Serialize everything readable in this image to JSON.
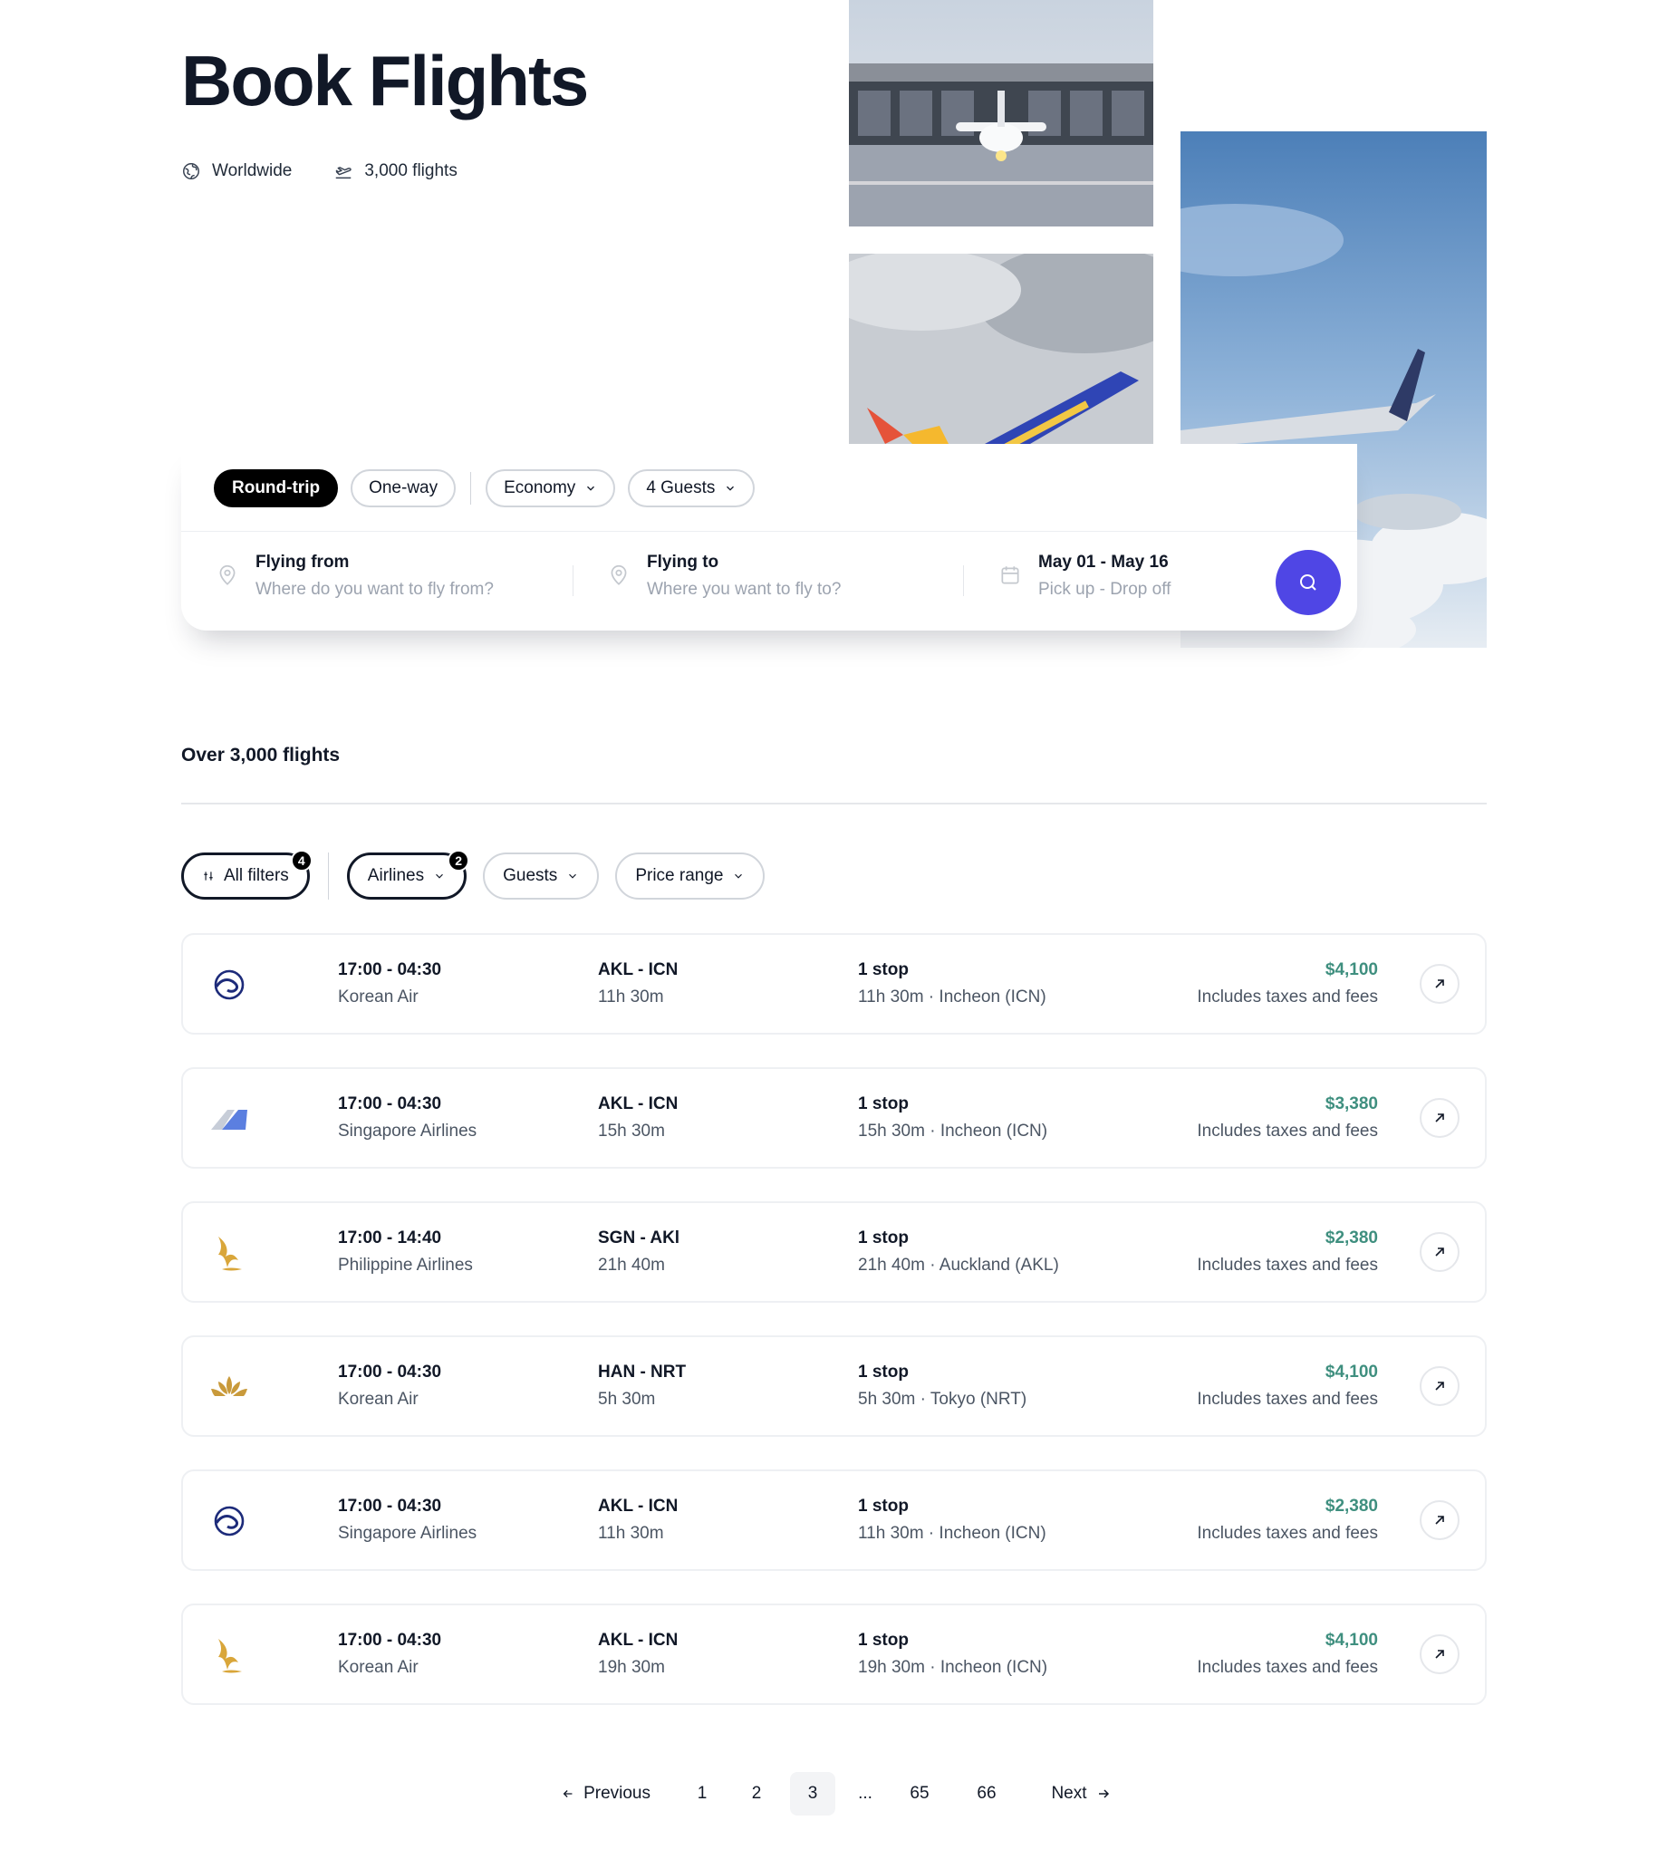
{
  "header": {
    "title": "Book Flights",
    "meta": [
      {
        "icon": "globe-icon",
        "label": "Worldwide"
      },
      {
        "icon": "plane-takeoff-icon",
        "label": "3,000 flights"
      }
    ]
  },
  "search": {
    "trip_types": [
      "Round-trip",
      "One-way"
    ],
    "active_trip": "Round-trip",
    "cabin_class": "Economy",
    "guests": "4 Guests",
    "from": {
      "label": "Flying from",
      "placeholder": "Where do you want to fly from?",
      "icon": "location-pin-icon"
    },
    "to": {
      "label": "Flying to",
      "placeholder": "Where you want to fly to?",
      "icon": "location-pin-icon"
    },
    "dates": {
      "label": "May 01 - May 16",
      "sub": "Pick up - Drop off",
      "icon": "calendar-icon"
    },
    "button_icon": "search-icon"
  },
  "results": {
    "title": "Over 3,000 flights",
    "filters": {
      "all_filters": {
        "label": "All filters",
        "badge": "4"
      },
      "airlines": {
        "label": "Airlines",
        "badge": "2"
      },
      "guests": {
        "label": "Guests"
      },
      "price_range": {
        "label": "Price range"
      }
    },
    "flights": [
      {
        "logo": "korean-air-logo-icon",
        "time": "17:00 - 04:30",
        "airline": "Korean Air",
        "route": "AKL - ICN",
        "duration": "11h 30m",
        "stops": "1 stop",
        "stop_detail": "11h 30m · Incheon (ICN)",
        "price": "$4,100",
        "price_note": "Includes taxes and fees"
      },
      {
        "logo": "tail-fin-logo-icon",
        "time": "17:00 - 04:30",
        "airline": "Singapore Airlines",
        "route": "AKL - ICN",
        "duration": "15h 30m",
        "stops": "1 stop",
        "stop_detail": "15h 30m · Incheon (ICN)",
        "price": "$3,380",
        "price_note": "Includes taxes and fees"
      },
      {
        "logo": "singapore-bird-logo-icon",
        "time": "17:00 - 14:40",
        "airline": "Philippine Airlines",
        "route": "SGN - AKl",
        "duration": "21h 40m",
        "stops": "1 stop",
        "stop_detail": "21h 40m · Auckland (AKL)",
        "price": "$2,380",
        "price_note": "Includes taxes and fees"
      },
      {
        "logo": "lotus-logo-icon",
        "time": "17:00 - 04:30",
        "airline": "Korean Air",
        "route": "HAN - NRT",
        "duration": "5h 30m",
        "stops": "1 stop",
        "stop_detail": "5h 30m · Tokyo (NRT)",
        "price": "$4,100",
        "price_note": "Includes taxes and fees"
      },
      {
        "logo": "korean-air-logo-icon",
        "time": "17:00 - 04:30",
        "airline": "Singapore Airlines",
        "route": "AKL - ICN",
        "duration": "11h 30m",
        "stops": "1 stop",
        "stop_detail": "11h 30m · Incheon (ICN)",
        "price": "$2,380",
        "price_note": "Includes taxes and fees"
      },
      {
        "logo": "singapore-bird-logo-icon",
        "time": "17:00 - 04:30",
        "airline": "Korean Air",
        "route": "AKL - ICN",
        "duration": "19h 30m",
        "stops": "1 stop",
        "stop_detail": "19h 30m · Incheon (ICN)",
        "price": "$4,100",
        "price_note": "Includes taxes and fees"
      }
    ]
  },
  "pagination": {
    "previous": "Previous",
    "next": "Next",
    "pages": [
      "1",
      "2",
      "3",
      "...",
      "65",
      "66"
    ],
    "current": "3"
  },
  "colors": {
    "accent": "#4f46e5",
    "price": "#3f8f7f",
    "korean_air": "#1d2b7a",
    "singapore_gold": "#d9a63a",
    "lotus_gold": "#c99a3b",
    "fin_blue": "#5b7fe0"
  }
}
